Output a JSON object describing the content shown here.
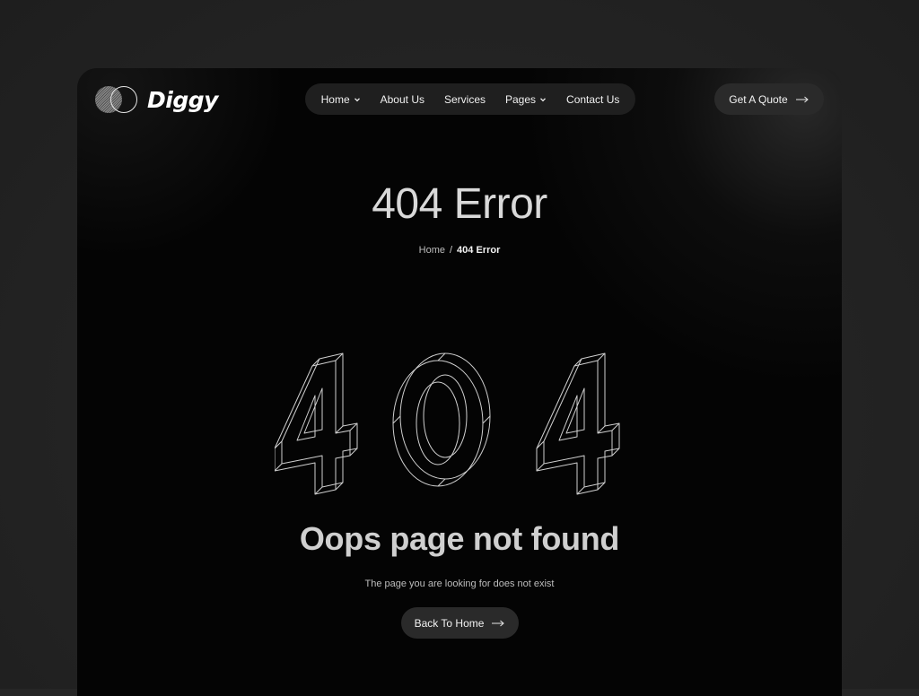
{
  "brand": {
    "name": "Diggy"
  },
  "nav": {
    "items": [
      {
        "label": "Home",
        "has_dropdown": true
      },
      {
        "label": "About Us",
        "has_dropdown": false
      },
      {
        "label": "Services",
        "has_dropdown": false
      },
      {
        "label": "Pages",
        "has_dropdown": true
      },
      {
        "label": "Contact Us",
        "has_dropdown": false
      }
    ],
    "cta_label": "Get A Quote"
  },
  "hero": {
    "title": "404 Error",
    "breadcrumb": {
      "home": "Home",
      "separator": "/",
      "current": "404 Error"
    }
  },
  "error": {
    "graphic_text": "404",
    "heading": "Oops page not found",
    "description": "The page you are looking for does not exist",
    "button_label": "Back To Home"
  },
  "icons": {
    "dropdown": "chevron-down-icon",
    "arrow": "arrow-right-icon"
  },
  "colors": {
    "page_background": "#262626",
    "frame_background": "#040404",
    "pill_background": "#1f1f1f",
    "button_background": "#2a2a2a",
    "outline": "#cfcfcf"
  }
}
